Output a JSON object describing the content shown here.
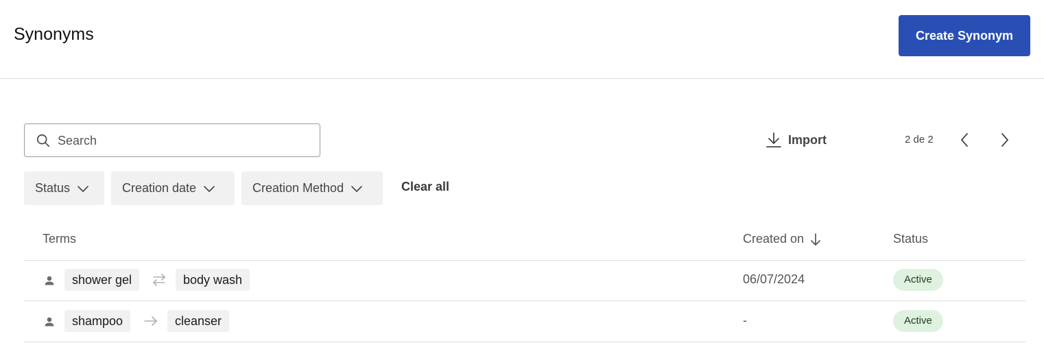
{
  "header": {
    "title": "Synonyms",
    "create_label": "Create Synonym"
  },
  "colors": {
    "accent": "#2a4fb4",
    "status_active_bg": "#def2df",
    "chip_bg": "#f1f1f1"
  },
  "search": {
    "placeholder": "Search",
    "value": ""
  },
  "toolbar": {
    "import_label": "Import",
    "pagination": "2 de 2"
  },
  "filters": {
    "status": "Status",
    "creation_date": "Creation date",
    "creation_method": "Creation Method",
    "clear_all": "Clear all"
  },
  "table": {
    "columns": {
      "terms": "Terms",
      "created_on": "Created on",
      "status": "Status"
    },
    "rows": [
      {
        "terms": [
          "shower gel",
          "body wash"
        ],
        "relation": "two-way",
        "relation_icon": "swap-arrows-icon",
        "creator_icon": "user-icon",
        "created_on": "06/07/2024",
        "status": "Active"
      },
      {
        "terms": [
          "shampoo",
          "cleanser"
        ],
        "relation": "one-way",
        "relation_icon": "arrow-right-icon",
        "creator_icon": "user-icon",
        "created_on": "-",
        "status": "Active"
      }
    ]
  }
}
